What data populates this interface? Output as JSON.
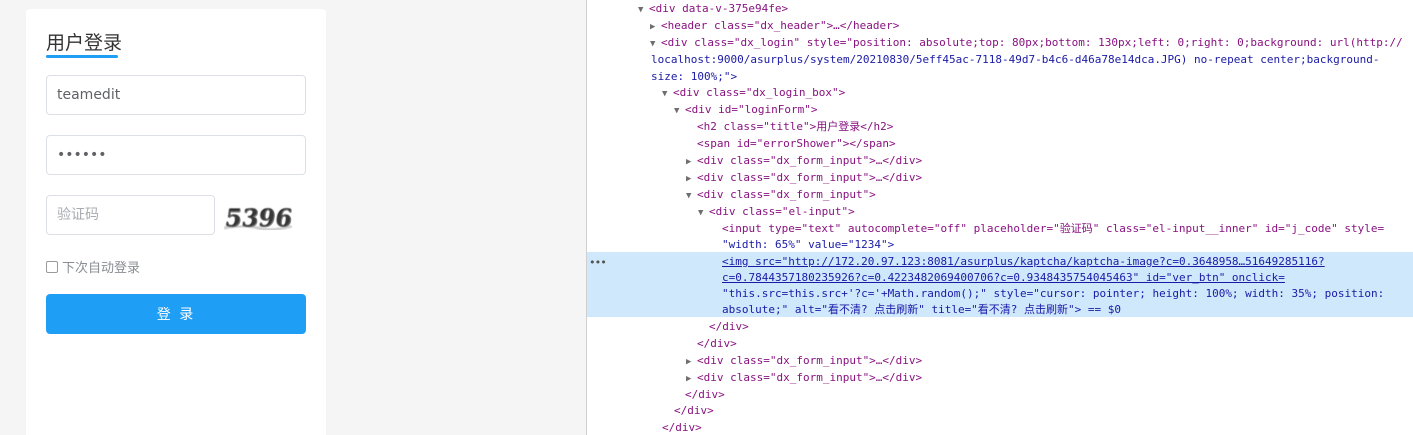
{
  "login": {
    "title": "用户登录",
    "username_value": "teamedit",
    "password_value": "••••••",
    "captcha_placeholder": "验证码",
    "captcha_text": "5396",
    "remember_label": "下次自动登录",
    "login_button": "登 录"
  },
  "devtools": {
    "lines": [
      {
        "text": "<div data-v-375e94fe>"
      },
      {
        "text": "<header class=\"dx_header\">…</header>"
      },
      {
        "text": "<div class=\"dx_login\" style=\"position: absolute;top: 80px;bottom: 130px;left: 0;right: 0;background: url(http://"
      },
      {
        "text": "localhost:9000/asurplus/system/20210830/5eff45ac-7118-49d7-b4c6-d46a78e14dca.JPG) no-repeat center;background-"
      },
      {
        "text": "size: 100%;\">"
      },
      {
        "text": "<div class=\"dx_login_box\">"
      },
      {
        "text": "<div id=\"loginForm\">"
      },
      {
        "text": "<h2 class=\"title\">用户登录</h2>"
      },
      {
        "text": "<span id=\"errorShower\"></span>"
      },
      {
        "text": "<div class=\"dx_form_input\">…</div>"
      },
      {
        "text": "<div class=\"dx_form_input\">…</div>"
      },
      {
        "text": "<div class=\"dx_form_input\">"
      },
      {
        "text": "<div class=\"el-input\">"
      },
      {
        "text": "<input type=\"text\" autocomplete=\"off\" placeholder=\"验证码\" class=\"el-input__inner\" id=\"j_code\" style="
      },
      {
        "text": "\"width: 65%\" value=\"1234\">"
      },
      {
        "text": "<img src=\"http://172.20.97.123:8081/asurplus/kaptcha/kaptcha-image?c=0.3648958…51649285116?"
      },
      {
        "text": "c=0.7844357180235926?c=0.4223482069400706?c=0.9348435754045463\" id=\"ver_btn\" onclick="
      },
      {
        "text": "\"this.src=this.src+'?c='+Math.random();\" style=\"cursor: pointer; height: 100%; width: 35%; position:"
      },
      {
        "text": "absolute;\" alt=\"看不清? 点击刷新\" title=\"看不清? 点击刷新\"> == $0"
      },
      {
        "text": "</div>"
      },
      {
        "text": "</div>"
      },
      {
        "text": "<div class=\"dx_form_input\">…</div>"
      },
      {
        "text": "<div class=\"dx_form_input\">…</div>"
      },
      {
        "text": "</div>"
      },
      {
        "text": "</div>"
      },
      {
        "text": "</div>"
      }
    ]
  }
}
